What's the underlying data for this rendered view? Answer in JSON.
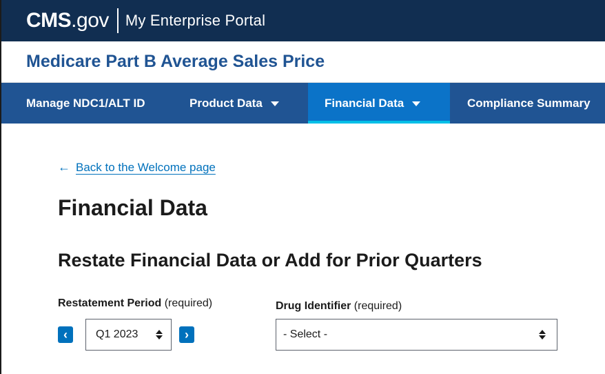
{
  "header": {
    "logo_cms": "CMS",
    "logo_gov": ".gov",
    "portal_name": "My Enterprise Portal"
  },
  "app": {
    "title": "Medicare Part B Average Sales Price"
  },
  "nav": {
    "items": [
      {
        "label": "Manage NDC1/ALT ID",
        "has_dropdown": false,
        "active": false
      },
      {
        "label": "Product Data",
        "has_dropdown": true,
        "active": false
      },
      {
        "label": "Financial Data",
        "has_dropdown": true,
        "active": true
      },
      {
        "label": "Compliance Summary",
        "has_dropdown": false,
        "active": false
      }
    ]
  },
  "main": {
    "back_link": "Back to the Welcome page",
    "back_icon": "arrow-left-icon",
    "page_title": "Financial Data",
    "section_title": "Restate Financial Data or Add for Prior Quarters",
    "restatement_period": {
      "label": "Restatement Period",
      "required_text": "(required)",
      "value": "Q1 2023",
      "prev_icon": "chevron-left-icon",
      "next_icon": "chevron-right-icon"
    },
    "drug_identifier": {
      "label": "Drug Identifier",
      "required_text": "(required)",
      "value": "- Select -"
    }
  },
  "colors": {
    "header_bg": "#112e51",
    "nav_bg": "#205493",
    "nav_active_bg": "#0b73c8",
    "nav_active_border": "#02bfe7",
    "app_title": "#205493",
    "link": "#0071bc",
    "button": "#0071bc"
  }
}
